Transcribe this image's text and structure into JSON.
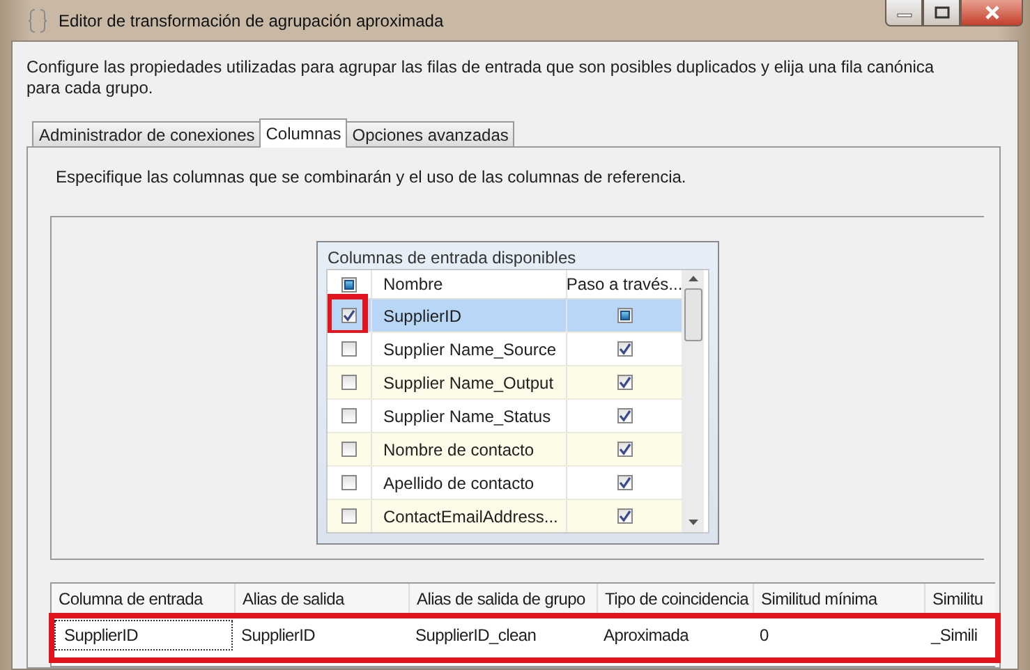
{
  "window": {
    "title": "Editor de transformación de agrupación aproximada"
  },
  "description": "Configure las propiedades utilizadas para agrupar las filas de entrada que son posibles duplicados y elija una fila canónica para cada grupo.",
  "tabs": [
    {
      "label": "Administrador de conexiones",
      "selected": false
    },
    {
      "label": "Columnas",
      "selected": true
    },
    {
      "label": "Opciones avanzadas",
      "selected": false
    }
  ],
  "instruction": "Especifique las columnas que se combinarán y el uso de las columnas de referencia.",
  "available_columns": {
    "title": "Columnas de entrada disponibles",
    "header_checked": true,
    "header_mixed": true,
    "columns": [
      "Nombre",
      "Paso a través..."
    ],
    "rows": [
      {
        "name": "SupplierID",
        "checked": true,
        "pass_through": true,
        "pass_through_mixed": true,
        "selected": true,
        "highlighted": true
      },
      {
        "name": "Supplier Name_Source",
        "checked": false,
        "pass_through": true,
        "pass_through_mixed": false,
        "selected": false,
        "highlighted": false
      },
      {
        "name": "Supplier Name_Output",
        "checked": false,
        "pass_through": true,
        "pass_through_mixed": false,
        "selected": false,
        "highlighted": false
      },
      {
        "name": "Supplier Name_Status",
        "checked": false,
        "pass_through": true,
        "pass_through_mixed": false,
        "selected": false,
        "highlighted": false
      },
      {
        "name": "Nombre de contacto",
        "checked": false,
        "pass_through": true,
        "pass_through_mixed": false,
        "selected": false,
        "highlighted": false
      },
      {
        "name": "Apellido de contacto",
        "checked": false,
        "pass_through": true,
        "pass_through_mixed": false,
        "selected": false,
        "highlighted": false
      },
      {
        "name": "ContactEmailAddress...",
        "checked": false,
        "pass_through": true,
        "pass_through_mixed": false,
        "selected": false,
        "highlighted": false
      }
    ]
  },
  "mapping": {
    "columns": [
      "Columna de entrada",
      "Alias de salida",
      "Alias de salida de grupo",
      "Tipo de coincidencia",
      "Similitud mínima",
      "Similitu"
    ],
    "rows": [
      {
        "cells": [
          "SupplierID",
          "SupplierID",
          "SupplierID_clean",
          "Aproximada",
          "0",
          "_Simili"
        ],
        "highlighted": true
      }
    ]
  }
}
